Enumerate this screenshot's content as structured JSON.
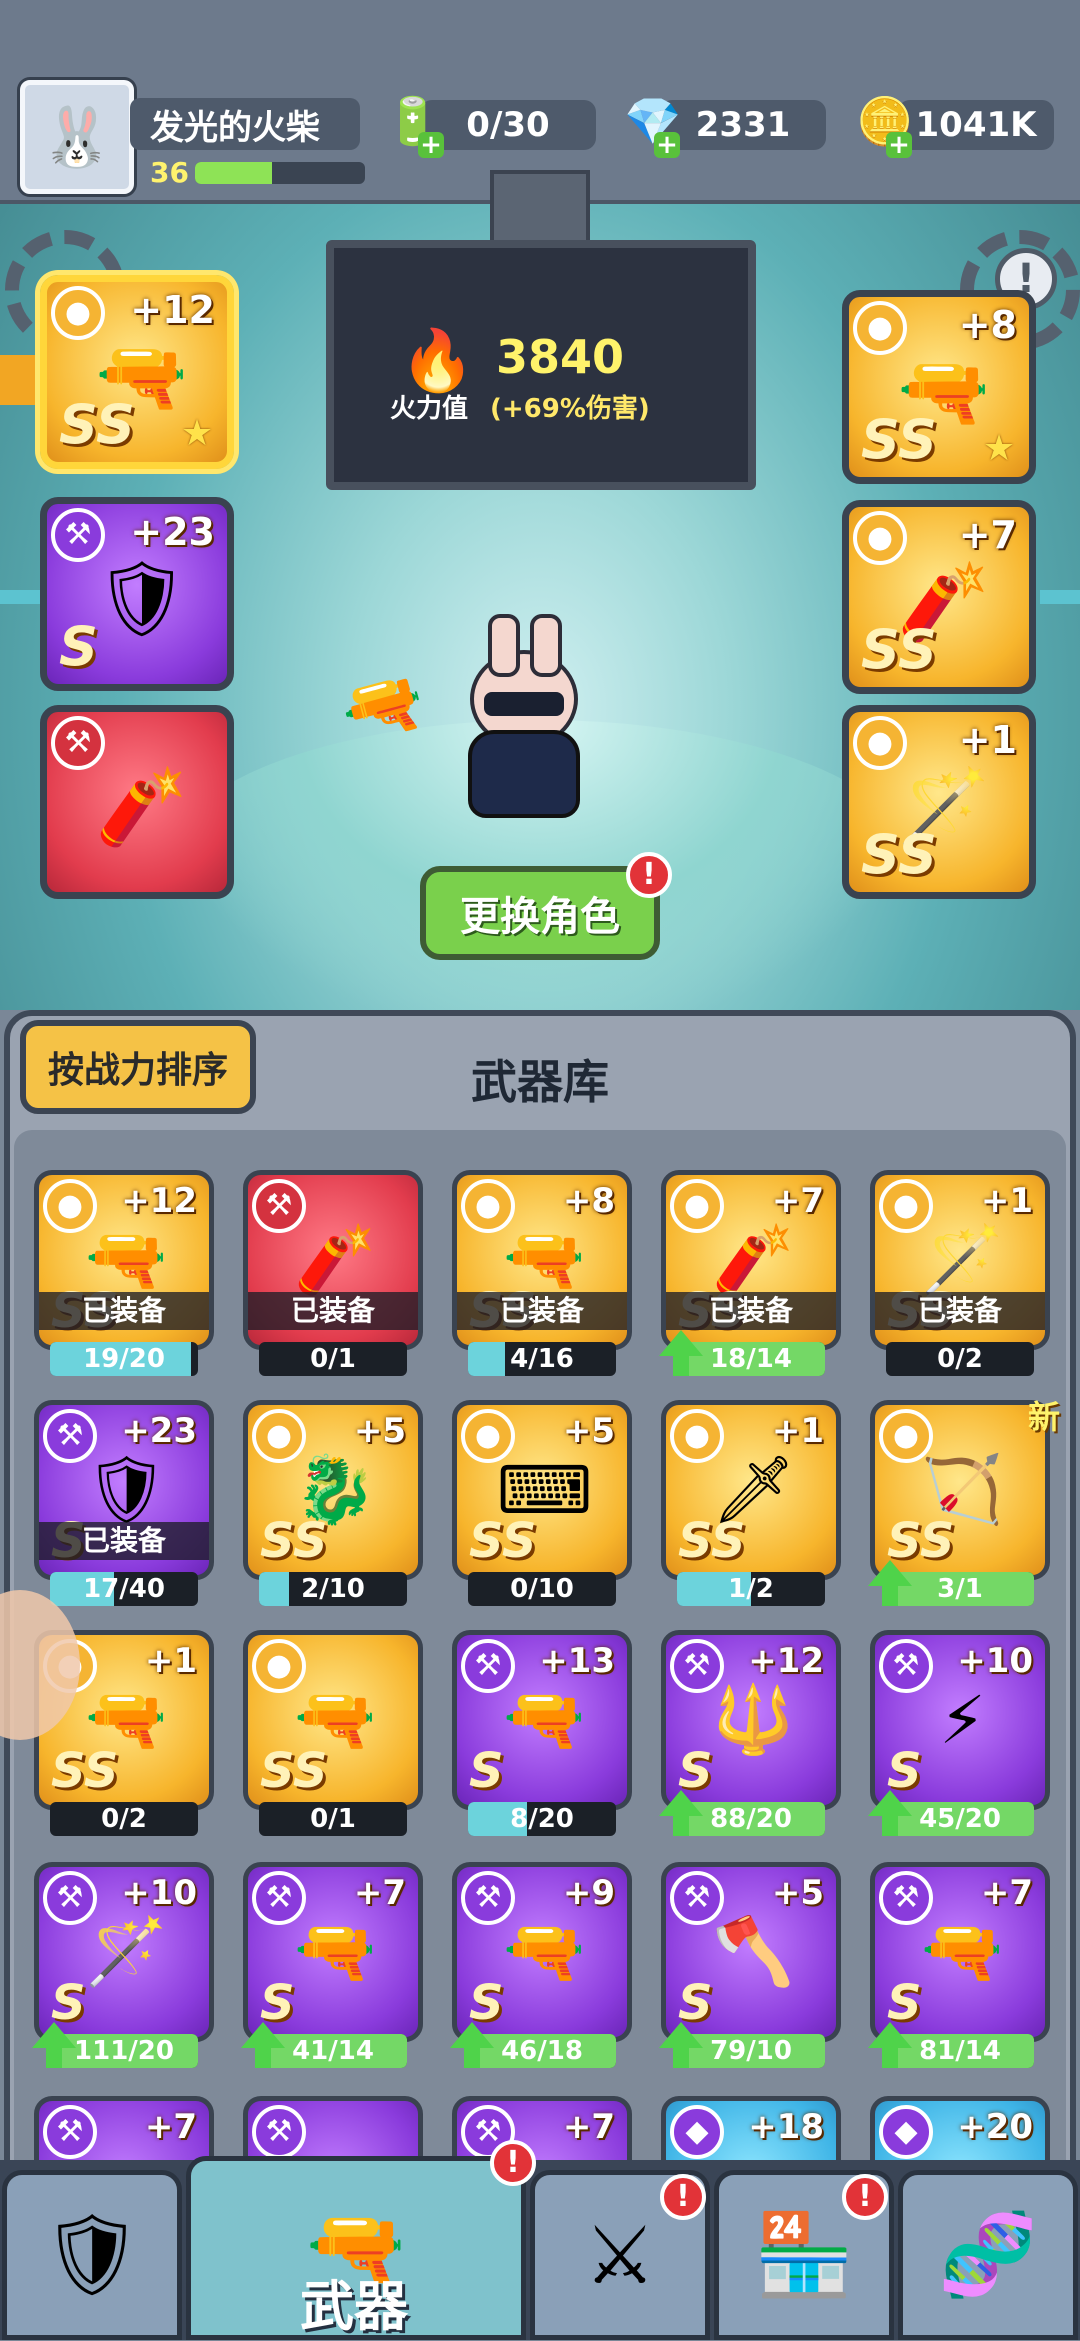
{
  "player": {
    "name": "发光的火柴",
    "level": "36",
    "xp_fraction": 0.45
  },
  "resources": {
    "energy": "0/30",
    "gems": "2331",
    "coins": "1041K"
  },
  "power": {
    "value": "3840",
    "label": "火力值",
    "bonus": "(+69%伤害)"
  },
  "change_role_label": "更换角色",
  "sort_label": "按战力排序",
  "armory_title": "武器库",
  "equipped_slots": {
    "left": [
      {
        "plus": "+12",
        "rank": "SS",
        "color": "gold",
        "icon": "minigun",
        "star": "1"
      },
      {
        "plus": "+23",
        "rank": "S",
        "color": "purple",
        "icon": "shield",
        "star": ""
      },
      {
        "plus": "",
        "rank": "",
        "color": "red",
        "icon": "bazooka",
        "star": ""
      }
    ],
    "right": [
      {
        "plus": "+8",
        "rank": "SS",
        "color": "gold",
        "icon": "pistol",
        "star": "1"
      },
      {
        "plus": "+7",
        "rank": "SS",
        "color": "gold",
        "icon": "firecracker",
        "star": ""
      },
      {
        "plus": "+1",
        "rank": "SS",
        "color": "gold",
        "icon": "staff",
        "star": ""
      }
    ]
  },
  "weapons": [
    {
      "plus": "+12",
      "rank": "SS",
      "color": "gold",
      "icon": "🔫",
      "equipped": "已装备",
      "progress": "19/20",
      "fill": 0.95,
      "up": false
    },
    {
      "plus": "",
      "rank": "",
      "color": "red",
      "icon": "🧨",
      "equipped": "已装备",
      "progress": "0/1",
      "fill": 0,
      "up": false
    },
    {
      "plus": "+8",
      "rank": "SS",
      "color": "gold",
      "icon": "🔫",
      "equipped": "已装备",
      "progress": "4/16",
      "fill": 0.25,
      "up": false
    },
    {
      "plus": "+7",
      "rank": "SS",
      "color": "gold",
      "icon": "🧨",
      "equipped": "已装备",
      "progress": "18/14",
      "fill": 1,
      "up": true
    },
    {
      "plus": "+1",
      "rank": "SS",
      "color": "gold",
      "icon": "🪄",
      "equipped": "已装备",
      "progress": "0/2",
      "fill": 0,
      "up": false
    },
    {
      "plus": "+23",
      "rank": "S",
      "color": "purple",
      "icon": "🛡",
      "equipped": "已装备",
      "progress": "17/40",
      "fill": 0.43,
      "up": false
    },
    {
      "plus": "+5",
      "rank": "SS",
      "color": "gold",
      "icon": "🐉",
      "equipped": "",
      "progress": "2/10",
      "fill": 0.2,
      "up": false
    },
    {
      "plus": "+5",
      "rank": "SS",
      "color": "gold",
      "icon": "⌨",
      "equipped": "",
      "progress": "0/10",
      "fill": 0,
      "up": false
    },
    {
      "plus": "+1",
      "rank": "SS",
      "color": "gold",
      "icon": "🗡",
      "equipped": "",
      "progress": "1/2",
      "fill": 0.5,
      "up": false
    },
    {
      "plus": "",
      "rank": "SS",
      "color": "gold",
      "icon": "🏹",
      "equipped": "",
      "progress": "3/1",
      "fill": 1,
      "up": true,
      "new": "新"
    },
    {
      "plus": "+1",
      "rank": "SS",
      "color": "gold",
      "icon": "🔫",
      "equipped": "",
      "progress": "0/2",
      "fill": 0,
      "up": false
    },
    {
      "plus": "",
      "rank": "SS",
      "color": "gold",
      "icon": "🔫",
      "equipped": "",
      "progress": "0/1",
      "fill": 0,
      "up": false
    },
    {
      "plus": "+13",
      "rank": "S",
      "color": "purple",
      "icon": "🔫",
      "equipped": "",
      "progress": "8/20",
      "fill": 0.4,
      "up": false
    },
    {
      "plus": "+12",
      "rank": "S",
      "color": "purple",
      "icon": "🔱",
      "equipped": "",
      "progress": "88/20",
      "fill": 1,
      "up": true
    },
    {
      "plus": "+10",
      "rank": "S",
      "color": "purple",
      "icon": "⚡",
      "equipped": "",
      "progress": "45/20",
      "fill": 1,
      "up": true
    },
    {
      "plus": "+10",
      "rank": "S",
      "color": "purple",
      "icon": "🪄",
      "equipped": "",
      "progress": "111/20",
      "fill": 1,
      "up": true
    },
    {
      "plus": "+7",
      "rank": "S",
      "color": "purple",
      "icon": "🔫",
      "equipped": "",
      "progress": "41/14",
      "fill": 1,
      "up": true
    },
    {
      "plus": "+9",
      "rank": "S",
      "color": "purple",
      "icon": "🔫",
      "equipped": "",
      "progress": "46/18",
      "fill": 1,
      "up": true
    },
    {
      "plus": "+5",
      "rank": "S",
      "color": "purple",
      "icon": "🪓",
      "equipped": "",
      "progress": "79/10",
      "fill": 1,
      "up": true
    },
    {
      "plus": "+7",
      "rank": "S",
      "color": "purple",
      "icon": "🔫",
      "equipped": "",
      "progress": "81/14",
      "fill": 1,
      "up": true
    },
    {
      "plus": "+7",
      "rank": "",
      "color": "purple",
      "icon": "",
      "equipped": "",
      "progress": "",
      "fill": 0,
      "up": false
    },
    {
      "plus": "",
      "rank": "",
      "color": "purple",
      "icon": "",
      "equipped": "",
      "progress": "",
      "fill": 0,
      "up": false
    },
    {
      "plus": "+7",
      "rank": "",
      "color": "purple",
      "icon": "",
      "equipped": "",
      "progress": "",
      "fill": 0,
      "up": false
    },
    {
      "plus": "+18",
      "rank": "",
      "color": "blue",
      "icon": "",
      "equipped": "",
      "progress": "",
      "fill": 0,
      "up": false
    },
    {
      "plus": "+20",
      "rank": "",
      "color": "blue",
      "icon": "",
      "equipped": "",
      "progress": "",
      "fill": 0,
      "up": false
    }
  ],
  "nav": {
    "active_label": "武器",
    "tabs": [
      "armor-icon",
      "weapon-icon",
      "battle-icon",
      "shop-icon",
      "dna-icon"
    ]
  }
}
